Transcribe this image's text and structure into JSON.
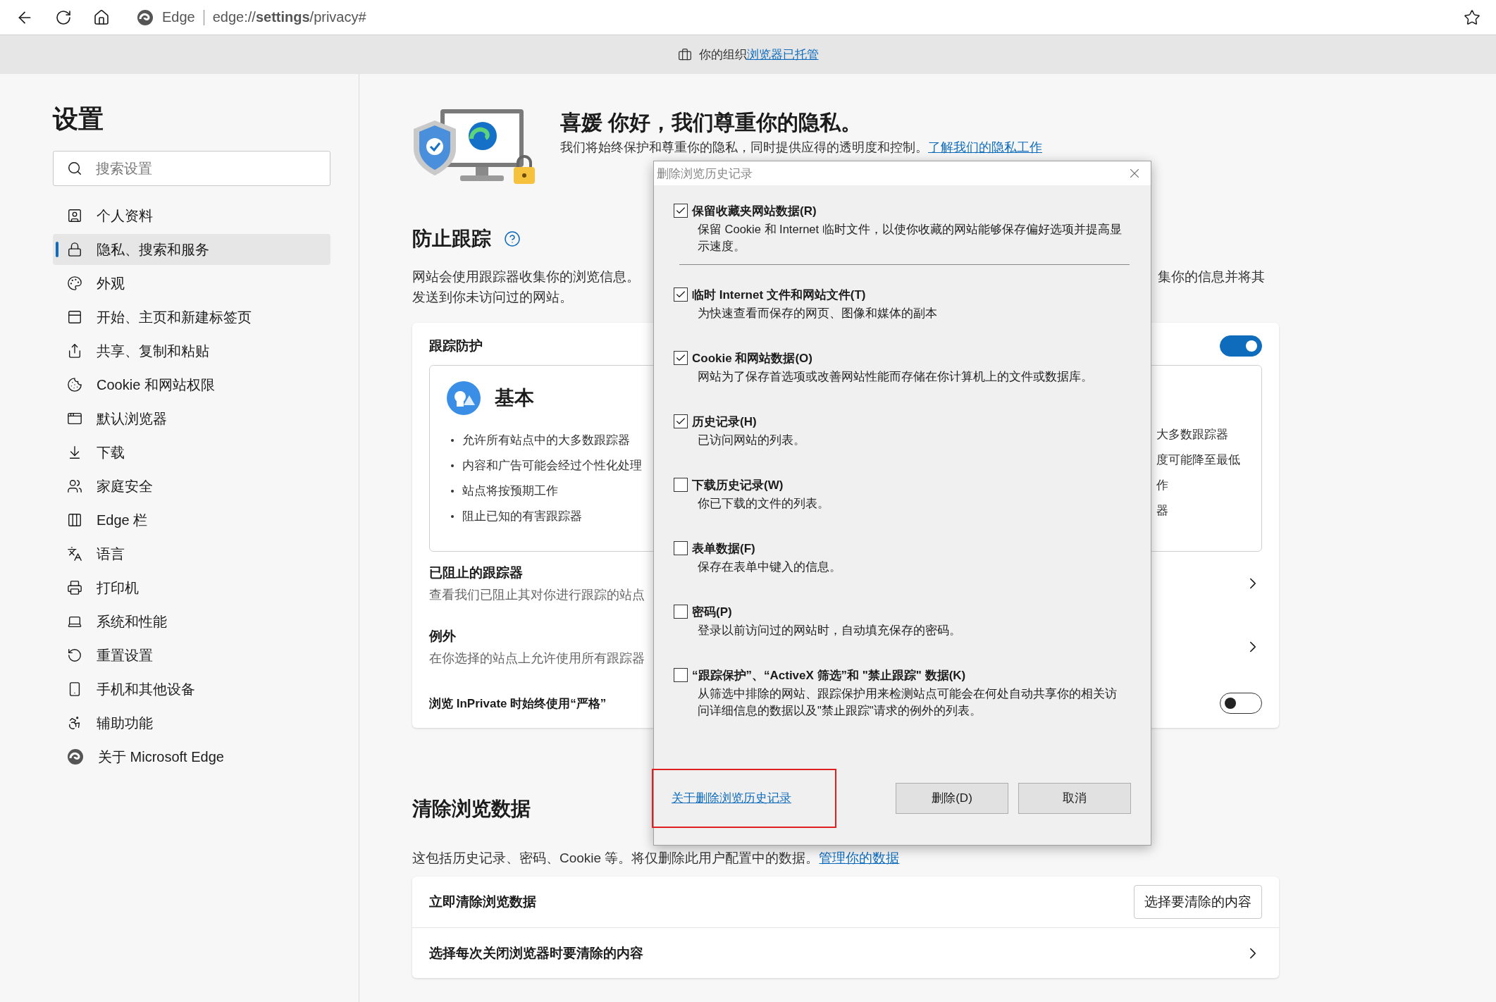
{
  "browser": {
    "product": "Edge",
    "address": "edge://**settings**/privacy#"
  },
  "managed_bar": {
    "text": "你的组织",
    "link": "浏览器已托管"
  },
  "sidebar": {
    "title": "设置",
    "search": {
      "placeholder": "搜索设置"
    },
    "items": [
      {
        "label": "个人资料",
        "selected": false
      },
      {
        "label": "隐私、搜索和服务",
        "selected": true
      },
      {
        "label": "外观",
        "selected": false
      },
      {
        "label": "开始、主页和新建标签页",
        "selected": false
      },
      {
        "label": "共享、复制和粘贴",
        "selected": false
      },
      {
        "label": "Cookie 和网站权限",
        "selected": false
      },
      {
        "label": "默认浏览器",
        "selected": false
      },
      {
        "label": "下载",
        "selected": false
      },
      {
        "label": "家庭安全",
        "selected": false
      },
      {
        "label": "Edge 栏",
        "selected": false
      },
      {
        "label": "语言",
        "selected": false
      },
      {
        "label": "打印机",
        "selected": false
      },
      {
        "label": "系统和性能",
        "selected": false
      },
      {
        "label": "重置设置",
        "selected": false
      },
      {
        "label": "手机和其他设备",
        "selected": false
      },
      {
        "label": "辅助功能",
        "selected": false
      },
      {
        "label": "关于 Microsoft Edge",
        "selected": false
      }
    ]
  },
  "hero": {
    "title": "喜媛 你好，我们尊重你的隐私。",
    "text": "我们将始终保护和尊重你的隐私，同时提供应得的透明度和控制。",
    "link": "了解我们的隐私工作"
  },
  "tracking": {
    "title": "防止跟踪",
    "description_parts": [
      "网站会使用跟踪器收集你的浏览信息。",
      "集你的信息并将其",
      "发送到你未访问过的网站。"
    ],
    "card": {
      "label": "跟踪防护",
      "on": true,
      "basic": {
        "title": "基本",
        "bullets": [
          "允许所有站点中的大多数跟踪器",
          "内容和广告可能会经过个性化处理",
          "站点将按预期工作",
          "阻止已知的有害跟踪器"
        ]
      },
      "strict_fragments": [
        "大多数跟踪器",
        "度可能降至最低",
        "作",
        "器"
      ],
      "rows": [
        {
          "kind": "link",
          "title": "已阻止的跟踪器",
          "subtitle": "查看我们已阻止其对你进行跟踪的站点"
        },
        {
          "kind": "link",
          "title": "例外",
          "subtitle": "在你选择的站点上允许使用所有跟踪器"
        },
        {
          "kind": "toggle",
          "title": "浏览 InPrivate 时始终使用“严格”",
          "on": false
        }
      ]
    }
  },
  "clear": {
    "title": "清除浏览数据",
    "text": "这包括历史记录、密码、Cookie 等。将仅删除此用户配置中的数据。",
    "link": "管理你的数据",
    "rows": [
      {
        "kind": "button",
        "title": "立即清除浏览数据",
        "button": "选择要清除的内容"
      },
      {
        "kind": "link",
        "title": "选择每次关闭浏览器时要清除的内容"
      }
    ]
  },
  "dialog": {
    "title": "删除浏览历史记录",
    "items": [
      {
        "label": "保留收藏夹网站数据(R)",
        "description": "保留 Cookie 和 Internet 临时文件，以使你收藏的网站能够保存偏好选项并提高显示速度。",
        "checked": true
      },
      {
        "label": "临时 Internet 文件和网站文件(T)",
        "description": "为快速查看而保存的网页、图像和媒体的副本",
        "checked": true
      },
      {
        "label": "Cookie 和网站数据(O)",
        "description": "网站为了保存首选项或改善网站性能而存储在你计算机上的文件或数据库。",
        "checked": true
      },
      {
        "label": "历史记录(H)",
        "description": "已访问网站的列表。",
        "checked": true
      },
      {
        "label": "下载历史记录(W)",
        "description": "你已下载的文件的列表。",
        "checked": false
      },
      {
        "label": "表单数据(F)",
        "description": "保存在表单中键入的信息。",
        "checked": false
      },
      {
        "label": "密码(P)",
        "description": "登录以前访问过的网站时，自动填充保存的密码。",
        "checked": false
      },
      {
        "label": "“跟踪保护”、“ActiveX 筛选”和 \"禁止跟踪\" 数据(K)",
        "description": "从筛选中排除的网站、跟踪保护用来检测站点可能会在何处自动共享你的相关访问详细信息的数据以及\"禁止跟踪\"请求的例外的列表。",
        "checked": false
      }
    ],
    "link": "关于删除浏览历史记录",
    "buttons": [
      "删除(D)",
      "取消"
    ]
  }
}
